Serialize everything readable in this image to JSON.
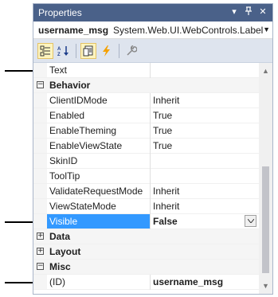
{
  "panel": {
    "title": "Properties",
    "title_buttons": {
      "dropdown": "▾",
      "pin": "ꟼ",
      "close": "✕"
    }
  },
  "object": {
    "name": "username_msg",
    "type": "System.Web.UI.WebControls.Label"
  },
  "toolbar": {
    "icons": [
      "categorized-icon",
      "alphabetical-icon",
      "properties-icon",
      "events-icon",
      "property-pages-icon"
    ]
  },
  "rows": [
    {
      "kind": "prop",
      "name": "Text",
      "value": ""
    },
    {
      "kind": "cat",
      "name": "Behavior",
      "toggle": "⊟"
    },
    {
      "kind": "prop",
      "name": "ClientIDMode",
      "value": "Inherit"
    },
    {
      "kind": "prop",
      "name": "Enabled",
      "value": "True"
    },
    {
      "kind": "prop",
      "name": "EnableTheming",
      "value": "True"
    },
    {
      "kind": "prop",
      "name": "EnableViewState",
      "value": "True"
    },
    {
      "kind": "prop",
      "name": "SkinID",
      "value": ""
    },
    {
      "kind": "prop",
      "name": "ToolTip",
      "value": ""
    },
    {
      "kind": "prop",
      "name": "ValidateRequestMode",
      "value": "Inherit"
    },
    {
      "kind": "prop",
      "name": "ViewStateMode",
      "value": "Inherit"
    },
    {
      "kind": "prop",
      "name": "Visible",
      "value": "False",
      "selected": true
    },
    {
      "kind": "cat",
      "name": "Data",
      "toggle": "⊞"
    },
    {
      "kind": "cat",
      "name": "Layout",
      "toggle": "⊞"
    },
    {
      "kind": "cat",
      "name": "Misc",
      "toggle": "⊟"
    },
    {
      "kind": "prop",
      "name": "(ID)",
      "value": "username_msg",
      "bold": true
    }
  ],
  "colors": {
    "titlebar": "#4a6189",
    "selection": "#3399ff",
    "toolbar": "#dee4ee"
  }
}
